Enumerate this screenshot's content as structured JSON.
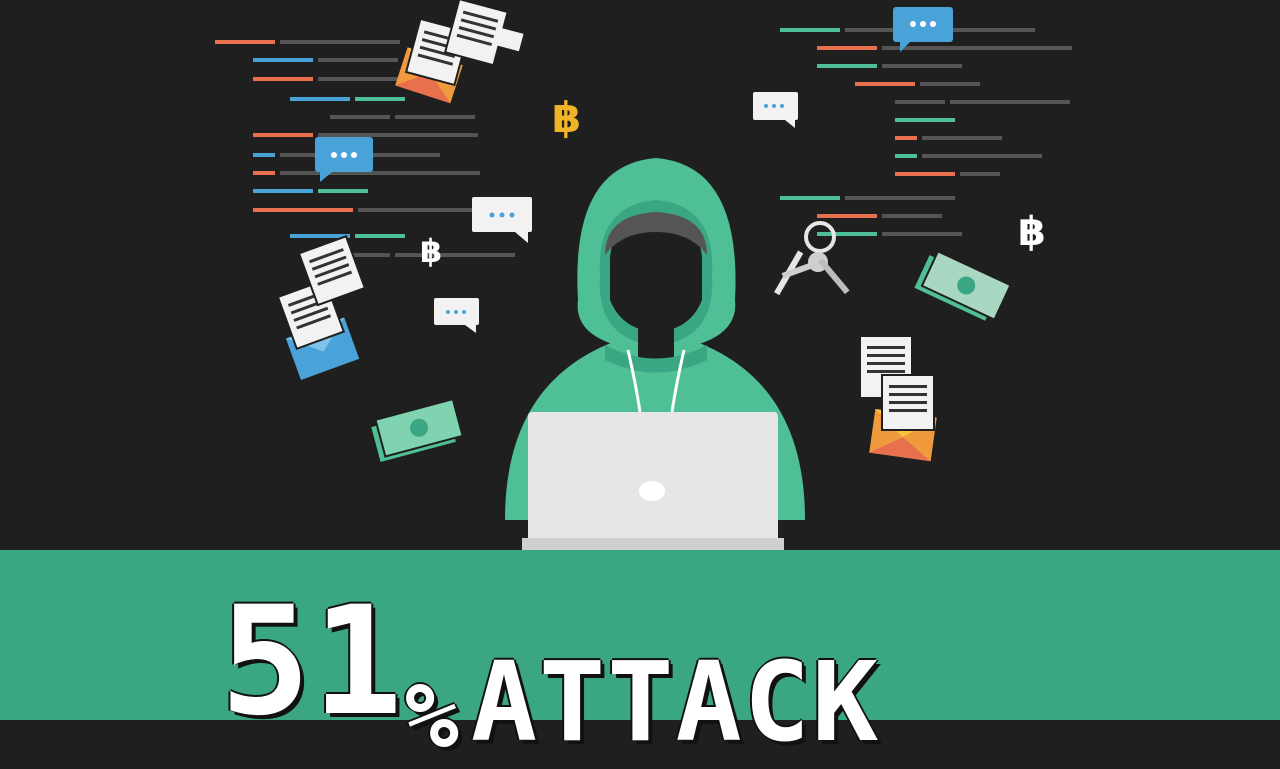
{
  "banner": {
    "number": "51",
    "percent_sign": "%",
    "word": "ATTACK"
  },
  "colors": {
    "background": "#1f1f1f",
    "banner_green": "#3aa683",
    "hoodie_green": "#4fbf95",
    "hoodie_dark": "#3aa683",
    "laptop": "#e6e6e6",
    "bitcoin_orange": "#f0b429",
    "code_orange": "#e8704c",
    "code_blue": "#4aa3d8",
    "code_green": "#4fbf95",
    "code_gray": "#555555",
    "envelope_orange": "#f09a3e",
    "envelope_blue": "#4aa3d8"
  },
  "icons": [
    "hacker-figure-icon",
    "laptop-icon",
    "bitcoin-icon",
    "chat-bubble-icon",
    "envelope-icon",
    "document-icon",
    "cash-icon",
    "keys-icon"
  ]
}
